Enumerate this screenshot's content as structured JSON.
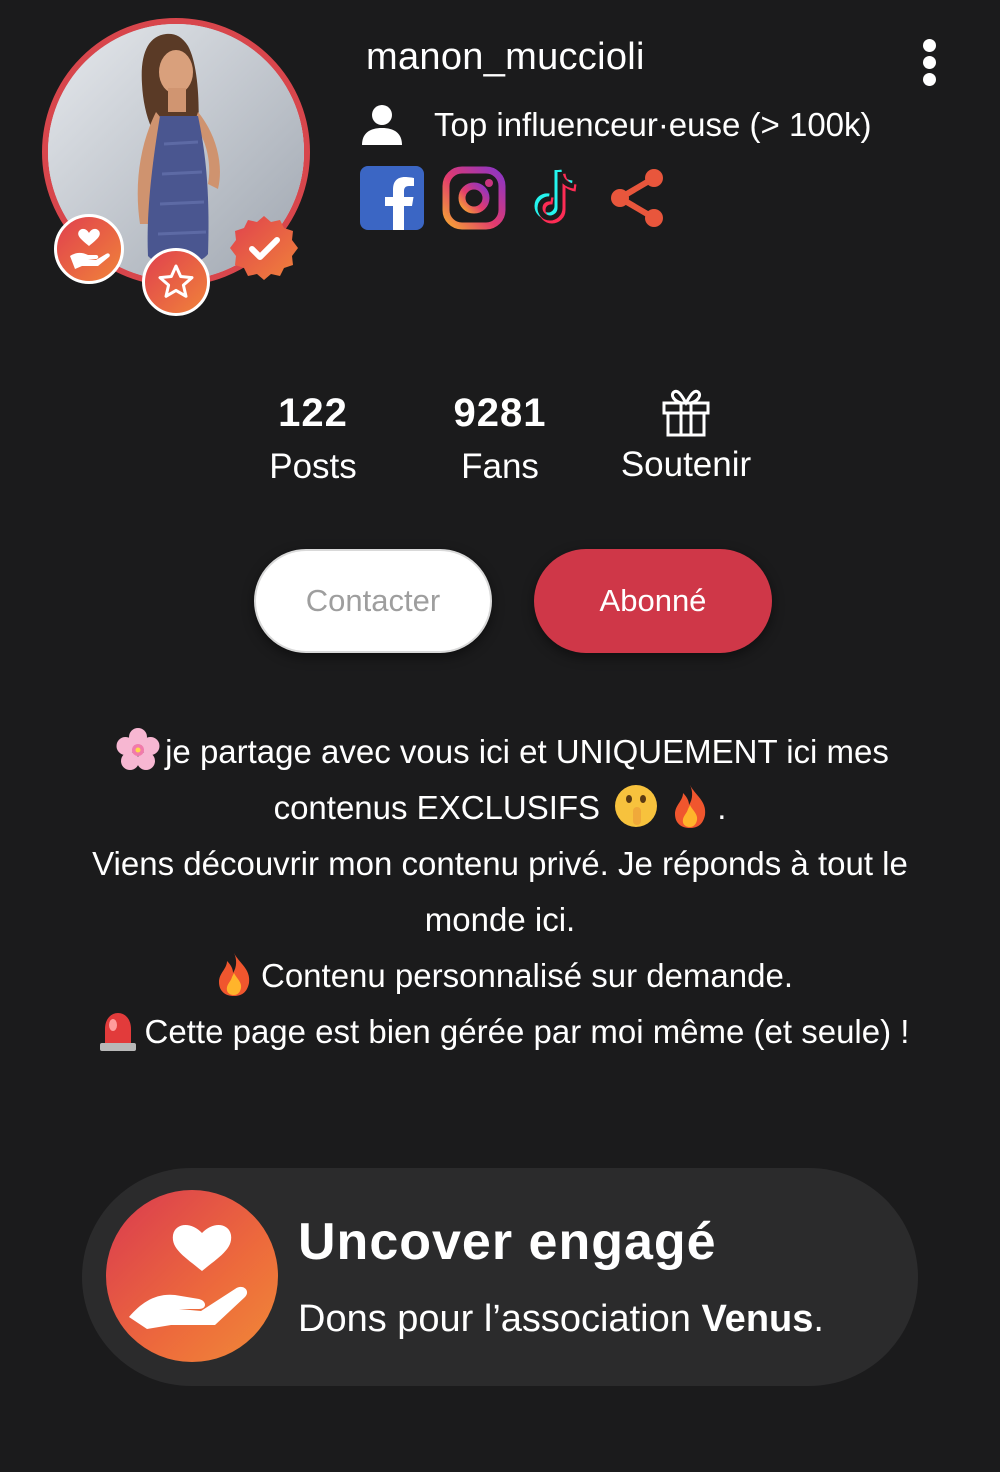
{
  "profile": {
    "username": "manon_muccioli",
    "category": "Top influenceur·euse (> 100k)",
    "avatar_ring_color": "#d8464c",
    "badges": [
      "charity-badge-icon",
      "star-badge-icon",
      "verified-badge-icon"
    ]
  },
  "socials": [
    {
      "name": "facebook-icon",
      "color": "#3b66c4"
    },
    {
      "name": "instagram-icon",
      "color": "#d6307d"
    },
    {
      "name": "tiktok-icon",
      "color": "#000000"
    },
    {
      "name": "share-icon",
      "color": "#e8563c"
    }
  ],
  "stats": {
    "posts_value": "122",
    "posts_label": "Posts",
    "fans_value": "9281",
    "fans_label": "Fans",
    "support_label": "Soutenir"
  },
  "buttons": {
    "contact_label": "Contacter",
    "subscribed_label": "Abonné",
    "accent_color": "#cf3748"
  },
  "bio": {
    "line1_text": "je partage avec vous ici et UNIQUEMENT ici  mes",
    "line2_text": "contenus EXCLUSIFS",
    "line2_end": ".",
    "line3_text": "Viens découvrir mon contenu privé. Je réponds à tout le",
    "line4_text": "monde ici.",
    "line5_text": "Contenu personnalisé sur demande.",
    "line6_text": "Cette page est bien gérée par moi même (et seule) !"
  },
  "charity": {
    "title": "Uncover engagé",
    "subtitle_prefix": "Dons pour l’association ",
    "subtitle_bold": "Venus",
    "subtitle_suffix": "."
  }
}
